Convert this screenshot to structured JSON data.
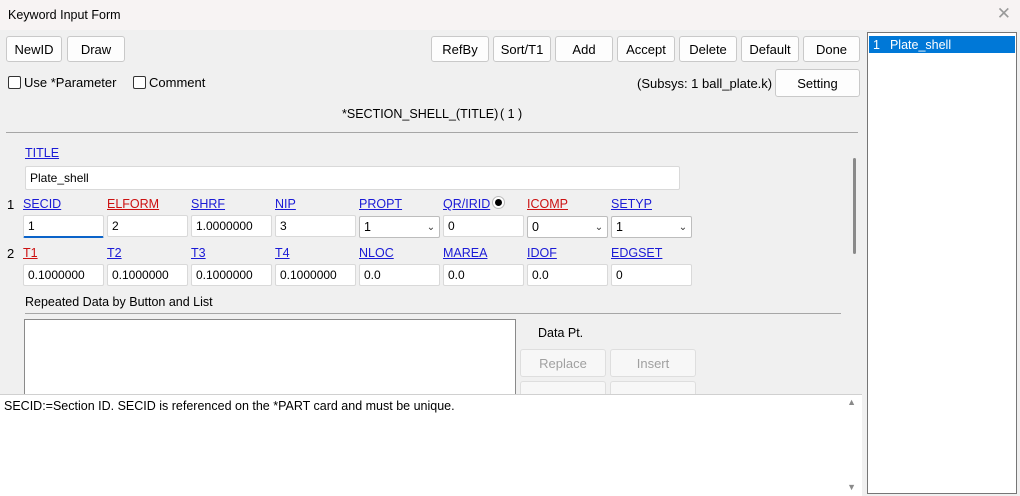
{
  "window": {
    "title": "Keyword Input Form"
  },
  "toolbar": {
    "newid": "NewID",
    "draw": "Draw",
    "refby": "RefBy",
    "sort": "Sort/T1",
    "add": "Add",
    "accept": "Accept",
    "delete": "Delete",
    "default": "Default",
    "done": "Done",
    "setting": "Setting"
  },
  "options": {
    "use_parameter": "Use *Parameter",
    "comment": "Comment",
    "subsys": "(Subsys: 1 ball_plate.k)"
  },
  "keyword": {
    "heading": "*SECTION_SHELL_(TITLE)",
    "count": "( 1 )"
  },
  "title_field": {
    "label": "TITLE",
    "value": "Plate_shell"
  },
  "card1": {
    "row": "1",
    "labels": [
      "SECID",
      "ELFORM",
      "SHRF",
      "NIP",
      "PROPT",
      "QR/IRID",
      "ICOMP",
      "SETYP"
    ],
    "values": [
      "1",
      "2",
      "1.0000000",
      "3",
      "1",
      "0",
      "0",
      "1"
    ]
  },
  "card2": {
    "row": "2",
    "labels": [
      "T1",
      "T2",
      "T3",
      "T4",
      "NLOC",
      "MAREA",
      "IDOF",
      "EDGSET"
    ],
    "values": [
      "0.1000000",
      "0.1000000",
      "0.1000000",
      "0.1000000",
      "0.0",
      "0.0",
      "0.0",
      "0"
    ]
  },
  "repeated": {
    "heading": "Repeated Data by Button and List",
    "data_pt": "Data Pt.",
    "replace": "Replace",
    "insert": "Insert"
  },
  "help": {
    "text": "SECID:=Section ID. SECID is referenced on the *PART card and must be unique."
  },
  "sidebar": {
    "items": [
      {
        "num": "1",
        "label": "Plate_shell"
      }
    ]
  },
  "colors": {
    "selection": "#0078d7",
    "link": "#1a1ad6",
    "required": "#cc1111"
  }
}
